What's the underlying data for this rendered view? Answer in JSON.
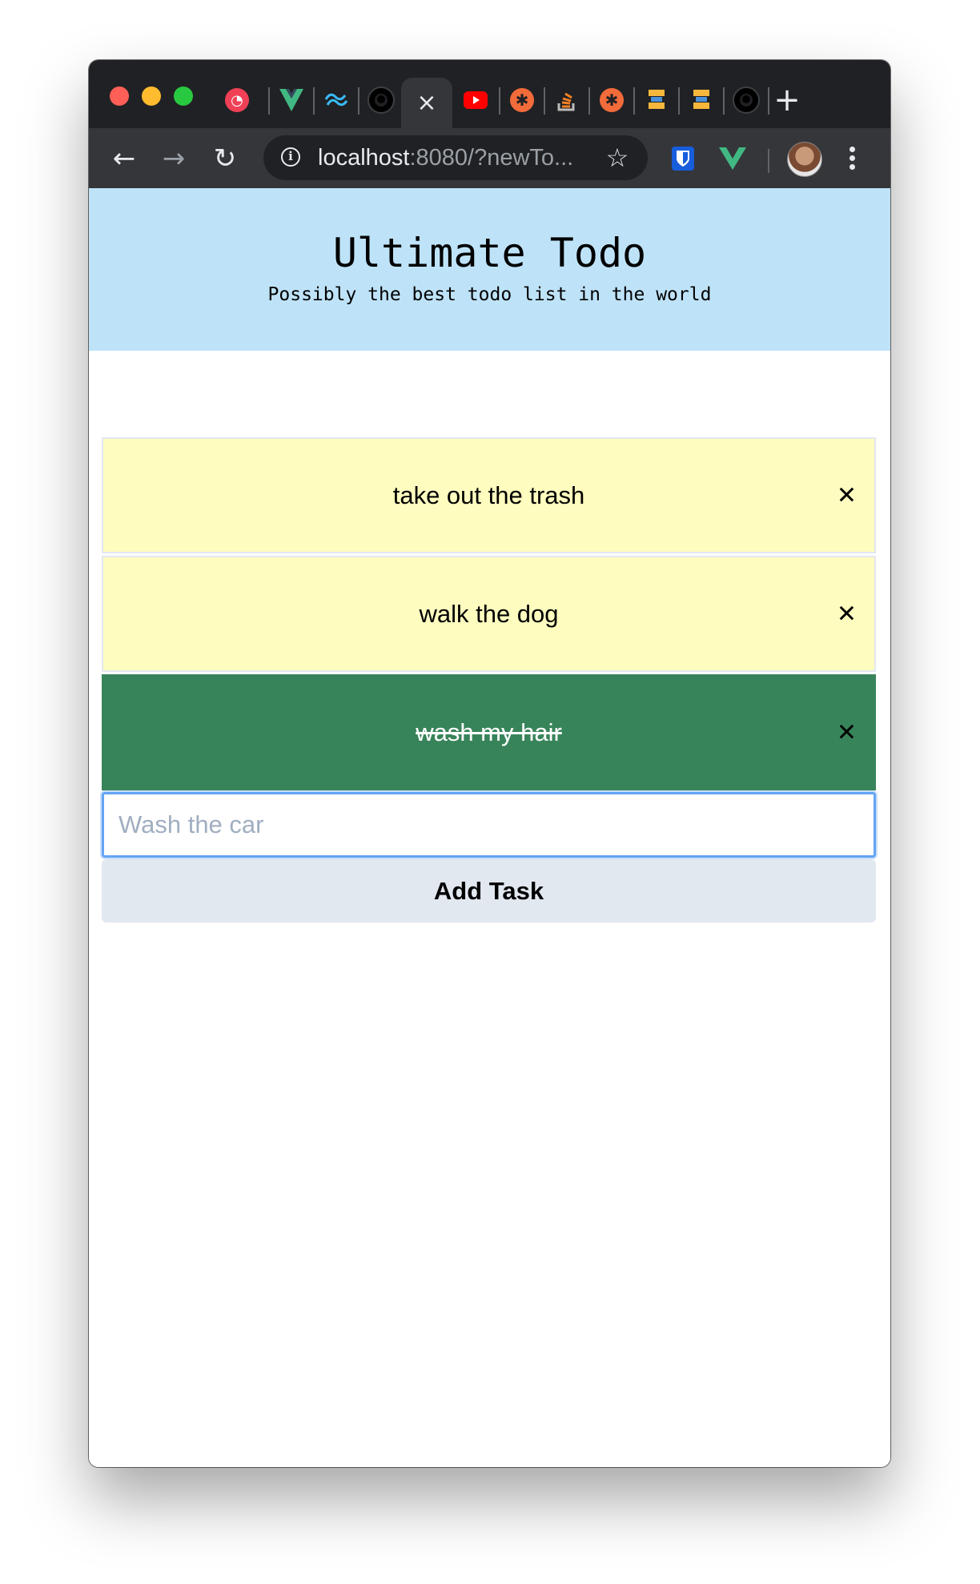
{
  "browser": {
    "tabs": [
      {
        "icon": "pocket-icon",
        "color": "#ef4056"
      },
      {
        "icon": "vue-icon",
        "color": "#41b883"
      },
      {
        "icon": "tailwind-icon",
        "color": "#38bdf8"
      },
      {
        "icon": "github-icon",
        "color": "#000000"
      },
      {
        "icon": "close-icon",
        "active": true,
        "close_glyph": "×"
      },
      {
        "icon": "youtube-icon",
        "color": "#ff0000"
      },
      {
        "icon": "asterisk-icon",
        "color": "#f26b3a"
      },
      {
        "icon": "stackoverflow-icon",
        "color": "#f48024"
      },
      {
        "icon": "asterisk-icon",
        "color": "#f26b3a"
      },
      {
        "icon": "bolt-icon",
        "color": "#f6b73c"
      },
      {
        "icon": "bolt-icon",
        "color": "#f6b73c"
      },
      {
        "icon": "github-icon",
        "color": "#000000"
      }
    ],
    "new_tab_glyph": "+",
    "url_host": "localhost",
    "url_rest": ":8080/?newTo...",
    "extensions": [
      {
        "icon": "bitwarden-icon",
        "color": "#175ddc"
      },
      {
        "icon": "vue-devtools-icon",
        "color": "#41b883"
      }
    ]
  },
  "app": {
    "title": "Ultimate Todo",
    "subtitle": "Possibly the best todo list in the world"
  },
  "todos": [
    {
      "label": "take out the trash",
      "done": false
    },
    {
      "label": "walk the dog",
      "done": false
    },
    {
      "label": "wash my hair",
      "done": true
    }
  ],
  "remove_glyph": "✕",
  "new_task": {
    "placeholder": "Wash the car",
    "value": "",
    "button_label": "Add Task"
  },
  "colors": {
    "header_bg": "#bee3f8",
    "pending_bg": "#fefcbf",
    "done_bg": "#38845a",
    "button_bg": "#e2e8f0",
    "focus_ring": "#63a4f4"
  }
}
